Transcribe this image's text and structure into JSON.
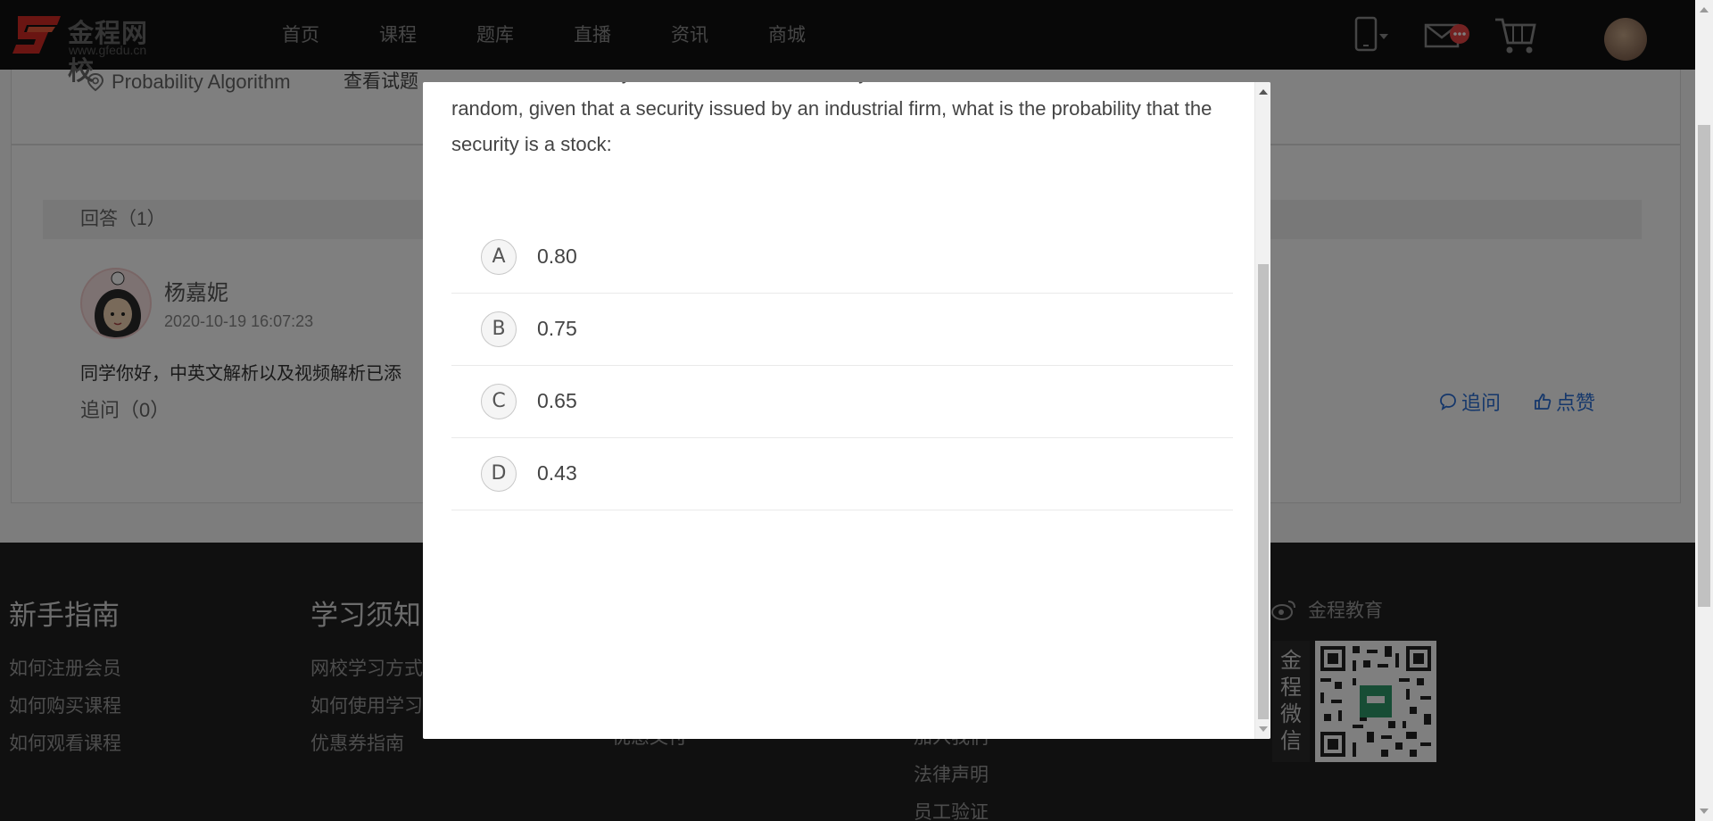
{
  "brand": {
    "name_cn": "金程网校",
    "url_text": "www.gfedu.cn"
  },
  "nav": {
    "items": [
      "首页",
      "课程",
      "题库",
      "直播",
      "资讯",
      "商城"
    ]
  },
  "header_icons": [
    "mobile-icon",
    "mail-icon",
    "cart-icon",
    "user-avatar"
  ],
  "question_meta": {
    "tag": "Probability Algorithm",
    "view_link": "查看试题"
  },
  "answers": {
    "heading": "回答（1）",
    "reply": {
      "user": "杨嘉妮",
      "time": "2020-10-19 16:07:23",
      "text_visible": "同学你好，中英文解析以及视频解析已添",
      "followup": "追问（0）",
      "action_ask": "追问",
      "action_like": "点赞"
    }
  },
  "footer": {
    "col1": {
      "title": "新手指南",
      "links": [
        "如何注册会员",
        "如何购买课程",
        "如何观看课程"
      ]
    },
    "col2": {
      "title": "学习须知",
      "links": [
        "网校学习方式",
        "如何使用学习",
        "优惠券指南"
      ]
    },
    "col3": {
      "links": [
        "优惠文付"
      ]
    },
    "col4": {
      "links": [
        "加入我们",
        "法律声明",
        "员工验证"
      ]
    },
    "weibo": "金程教育",
    "wechat_label": "金程微信"
  },
  "modal": {
    "question_cut_line": "the industrial firms, you are told that the security selected at random",
    "question_text": "random, given that a security issued by an industrial firm, what is the probability that the security is a stock:",
    "options": [
      {
        "letter": "A",
        "value": "0.80"
      },
      {
        "letter": "B",
        "value": "0.75"
      },
      {
        "letter": "C",
        "value": "0.65"
      },
      {
        "letter": "D",
        "value": "0.43"
      }
    ]
  },
  "colors": {
    "topbar": "#111111",
    "footer": "#202020",
    "link_blue": "#2a6fd6",
    "logo_red": "#e2332b"
  }
}
